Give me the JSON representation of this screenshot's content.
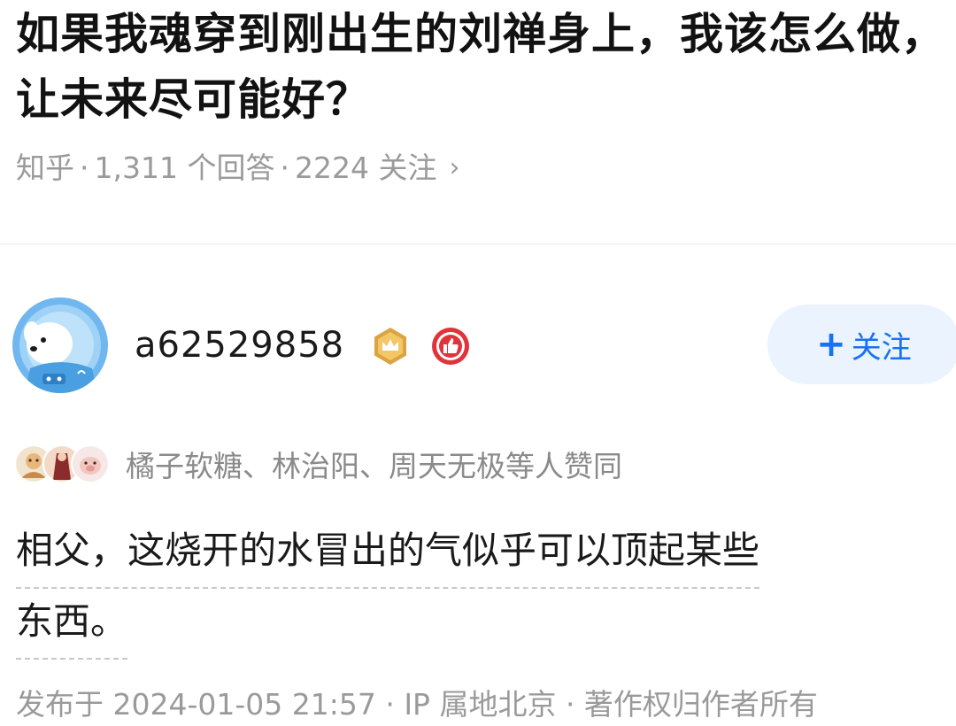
{
  "question": {
    "title": "如果我魂穿到刚出生的刘禅身上，我该怎么做，让未来尽可能好？",
    "source": "知乎",
    "answers_count": "1,311 个回答",
    "followers": "2224 关注",
    "separator": "·",
    "chevron": "›"
  },
  "author": {
    "avatar_icon": "dog-astronaut-avatar-icon",
    "name": "a62529858",
    "badges": [
      "crown-badge-icon",
      "thumb-up-badge-icon"
    ]
  },
  "follow_button": {
    "plus": "+",
    "label": "关注"
  },
  "voters": {
    "avatars": [
      "voter-avatar-1",
      "voter-avatar-2",
      "voter-avatar-3"
    ],
    "text": "橘子软糖、林治阳、周天无极等人赞同"
  },
  "answer": {
    "lines": [
      "相父，这烧开的水冒出的气似乎可以顶起某些",
      "东西。"
    ]
  },
  "publish_info": "发布于 2024-01-05 21:57 · IP 属地北京 · 著作权归作者所有",
  "colors": {
    "accent": "#1772f6",
    "follow_bg": "#eaf3fe",
    "meta_text": "#9a9a9a",
    "badge_gold": "#d9a441",
    "badge_red": "#e0343a"
  }
}
